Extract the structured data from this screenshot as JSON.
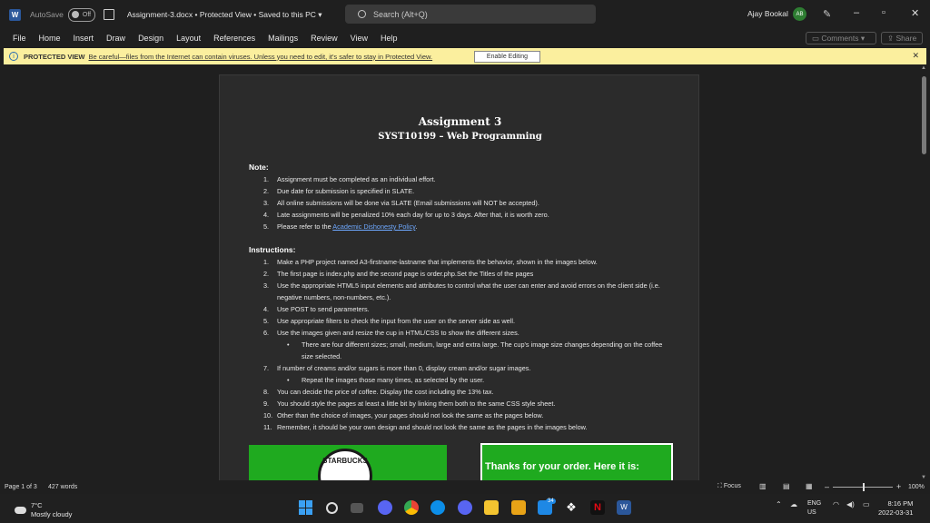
{
  "titlebar": {
    "autosave_label": "AutoSave",
    "autosave_state": "Off",
    "document_title": "Assignment-3.docx  •  Protected View • Saved to this PC  ▾",
    "search_placeholder": "Search (Alt+Q)",
    "user_name": "Ajay Bookal",
    "user_initials": "AB"
  },
  "menu": {
    "items": [
      "File",
      "Home",
      "Insert",
      "Draw",
      "Design",
      "Layout",
      "References",
      "Mailings",
      "Review",
      "View",
      "Help"
    ],
    "comments_label": "Comments",
    "share_label": "Share"
  },
  "protected_view": {
    "label": "PROTECTED VIEW",
    "message": "Be careful—files from the Internet can contain viruses. Unless you need to edit, it's safer to stay in Protected View.",
    "enable_button": "Enable Editing"
  },
  "document": {
    "title": "Assignment 3",
    "subtitle": "SYST10199 – Web Programming",
    "note_heading": "Note:",
    "notes": [
      {
        "n": "1.",
        "text": "Assignment must be completed as an individual effort."
      },
      {
        "n": "2.",
        "text": "Due date for submission is specified in SLATE."
      },
      {
        "n": "3.",
        "text": "All online submissions will be done via SLATE (Email submissions will NOT be accepted)."
      },
      {
        "n": "4.",
        "text": "Late assignments will be penalized 10% each day for up to 3 days. After that, it is worth zero."
      },
      {
        "n": "5.",
        "text_before": "Please refer to the ",
        "link": "Academic Dishonesty Policy",
        "text_after": "."
      }
    ],
    "instructions_heading": "Instructions:",
    "instructions": [
      {
        "n": "1.",
        "text": "Make a PHP project named A3-firstname-lastname that implements the behavior, shown in the images below."
      },
      {
        "n": "2.",
        "text": "The first page is index.php and the second page is order.php.Set the Titles of the pages"
      },
      {
        "n": "3.",
        "text": "Use the appropriate HTML5 input elements and attributes to control what the user can enter and avoid errors on the client side (i.e. negative numbers, non-numbers, etc.)."
      },
      {
        "n": "4.",
        "text": "Use POST to send parameters."
      },
      {
        "n": "5.",
        "text": "Use appropriate filters to check the input from the user on the server side as well."
      },
      {
        "n": "6.",
        "text": "Use the images given and resize the cup in HTML/CSS to show the different sizes."
      },
      {
        "n": "•",
        "sub": true,
        "text": "There are four different sizes; small, medium, large and extra large. The cup's image size changes depending on the coffee size selected."
      },
      {
        "n": "7.",
        "text": "If number of creams and/or sugars is more than 0, display cream and/or sugar images."
      },
      {
        "n": "•",
        "sub": true,
        "text": "Repeat the images those many times, as selected by the user."
      },
      {
        "n": "8.",
        "text": "You can decide the price of coffee. Display the cost including the 13% tax."
      },
      {
        "n": "9.",
        "text": "You should style the pages at least a little bit by linking them both to the same CSS style sheet."
      },
      {
        "n": "10.",
        "text": "Other than the choice of images, your pages should not look the same as the pages below."
      },
      {
        "n": "11.",
        "text": "Remember, it should be your own design and should not look the same as the pages in the images below."
      }
    ],
    "logo_text": "STARBUCKS",
    "thanks_text": "Thanks for your order. Here it is:"
  },
  "status": {
    "page": "Page 1 of 3",
    "words": "427 words",
    "focus": "Focus",
    "zoom": "100%"
  },
  "taskbar": {
    "weather_temp": "7°C",
    "weather_desc": "Mostly cloudy",
    "lang_1": "ENG",
    "lang_2": "US",
    "time": "8:16 PM",
    "date": "2022-03-31",
    "mail_badge": "34"
  }
}
